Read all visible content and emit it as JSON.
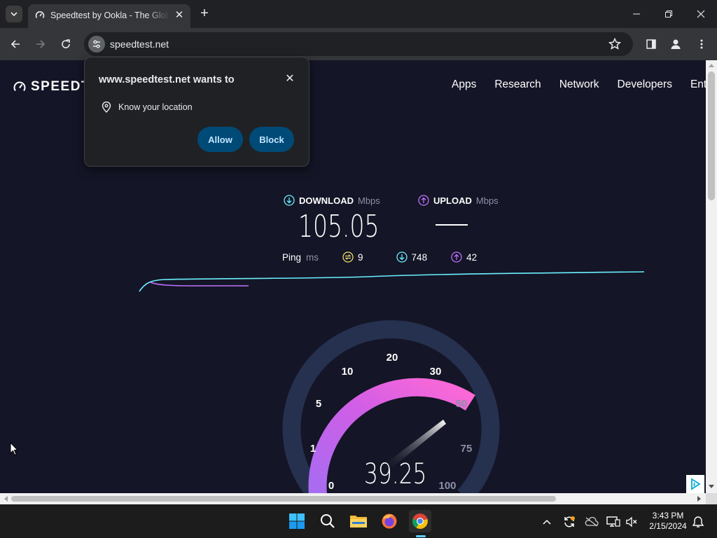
{
  "browser": {
    "tab_title": "Speedtest by Ookla - The Global Broadband Speed Test",
    "url": "speedtest.net"
  },
  "site": {
    "logo": "SPEEDTEST",
    "nav": [
      "Apps",
      "Research",
      "Network",
      "Developers",
      "Enterprise"
    ]
  },
  "results": {
    "download_label": "DOWNLOAD",
    "download_unit": "Mbps",
    "download_value": "105.05",
    "upload_label": "UPLOAD",
    "upload_unit": "Mbps",
    "upload_value": "—",
    "ping_label": "Ping",
    "ping_unit": "ms",
    "ping_idle": "9",
    "ping_download": "748",
    "ping_upload": "42"
  },
  "gauge": {
    "scale_labels": [
      "0",
      "1",
      "5",
      "10",
      "20",
      "30",
      "50",
      "75",
      "100"
    ],
    "current_value": "39.25",
    "needle_value": 39.25
  },
  "popup": {
    "title": "www.speedtest.net wants to",
    "permission": "Know your location",
    "allow_label": "Allow",
    "block_label": "Block"
  },
  "taskbar": {
    "time": "3:43 PM",
    "date": "2/15/2024"
  },
  "colors": {
    "page_bg": "#141526",
    "download_accent": "#6af0ff",
    "upload_accent": "#bf71ff",
    "gauge_pink": "#e84fd8",
    "gauge_purple": "#b56af7",
    "popup_button": "#004a77"
  }
}
